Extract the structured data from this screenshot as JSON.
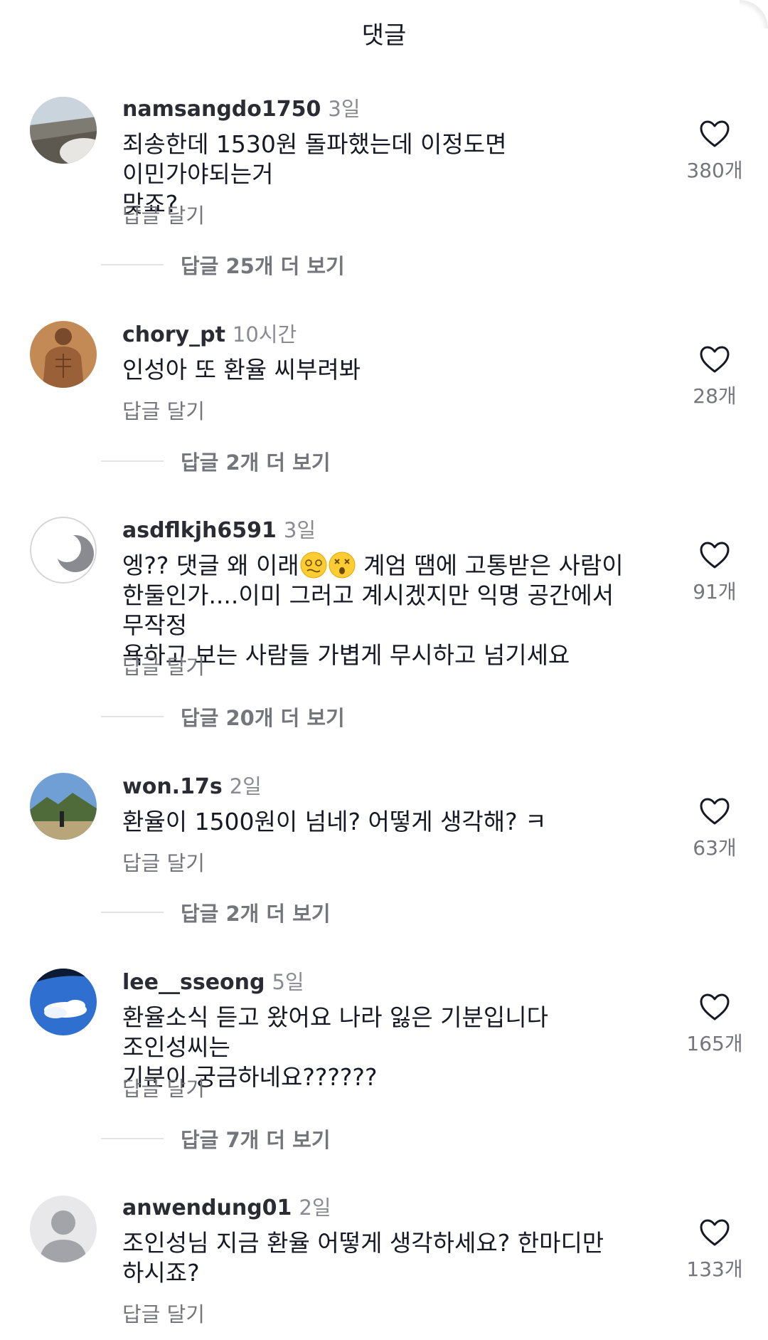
{
  "header": {
    "title": "댓글"
  },
  "comments": [
    {
      "username": "namsangdo1750",
      "time": "3일",
      "lines": [
        "죄송한데 1530원 돌파했는데 이정도면 이민가야되는거",
        "맞죠?"
      ],
      "reply_label": "답글 달기",
      "likes": "380개",
      "more_replies": "답글 25개 더 보기"
    },
    {
      "username": "chory_pt",
      "time": "10시간",
      "lines": [
        "인성아 또 환율 씨부려봐"
      ],
      "reply_label": "답글 달기",
      "likes": "28개",
      "more_replies": "답글 2개 더 보기"
    },
    {
      "username": "asdflkjh6591",
      "time": "3일",
      "line1_a": "엥?? 댓글 왜 이래",
      "line1_b": " 계엄 땜에 고통받은 사람이",
      "lines": [
        "",
        "한둘인가....이미 그러고 계시겠지만 익명 공간에서 무작정",
        "욕하고 보는 사람들 가볍게 무시하고 넘기세요"
      ],
      "emojis": [
        "dizzy-face-emoji",
        "astonished-face-emoji"
      ],
      "reply_label": "답글 달기",
      "likes": "91개",
      "more_replies": "답글 20개 더 보기"
    },
    {
      "username": "won.17s",
      "time": "2일",
      "lines": [
        "환율이 1500원이 넘네? 어떻게 생각해? ㅋ"
      ],
      "reply_label": "답글 달기",
      "likes": "63개",
      "more_replies": "답글 2개 더 보기"
    },
    {
      "username": "lee__sseong",
      "time": "5일",
      "lines": [
        "환율소식 듣고 왔어요 나라 잃은 기분입니다  조인성씨는",
        "기분이 궁금하네요??????"
      ],
      "reply_label": "답글 달기",
      "likes": "165개",
      "more_replies": "답글 7개 더 보기"
    },
    {
      "username": "anwendung01",
      "time": "2일",
      "lines": [
        "조인성님 지금 환율 어떻게 생각하세요? 한마디만",
        "하시죠?"
      ],
      "reply_label": "답글 달기",
      "likes": "133개"
    }
  ],
  "icons": {
    "like": "heart-outline-icon"
  },
  "colors": {
    "text": "#161823",
    "secondary": "#75767c",
    "divider": "#e3e3e4"
  }
}
